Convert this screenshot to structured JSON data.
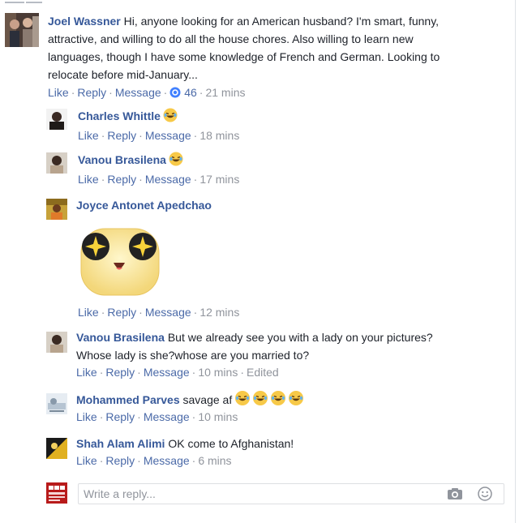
{
  "colors": {
    "author": "#365899",
    "link": "#4b6aa8",
    "meta": "#90949c",
    "reply_badge": "#4080ff"
  },
  "top_comment": {
    "author": "Joel Wassner",
    "lines": [
      "Hi, anyone looking for an American husband? I'm smart, funny,",
      "attractive, and willing to do all the house chores. Also willing to learn new",
      "languages, though I have some knowledge of French and German. Looking to",
      "relocate before mid-January..."
    ],
    "actions": {
      "like": "Like",
      "reply": "Reply",
      "message": "Message",
      "reply_count": "46",
      "time": "21 mins"
    },
    "reply_count_icon": "reply-bubble-icon"
  },
  "replies": [
    {
      "author": "Charles Whittle",
      "text": "",
      "emoji": "laughing-emoji",
      "actions": {
        "like": "Like",
        "reply": "Reply",
        "message": "Message",
        "time": "18 mins"
      }
    },
    {
      "author": "Vanou Brasilena",
      "text": "",
      "emoji": "laughing-emoji",
      "actions": {
        "like": "Like",
        "reply": "Reply",
        "message": "Message",
        "time": "17 mins"
      }
    },
    {
      "author": "Joyce Antonet Apedchao",
      "text": "",
      "sticker": "starry-eyes-sticker",
      "actions": {
        "like": "Like",
        "reply": "Reply",
        "message": "Message",
        "time": "12 mins"
      }
    },
    {
      "author": "Vanou Brasilena",
      "text": "But we already see you with a lady on your pictures?",
      "text2": "Whose lady is she?whose are you married to?",
      "actions": {
        "like": "Like",
        "reply": "Reply",
        "message": "Message",
        "time": "10 mins",
        "edited": "Edited"
      }
    },
    {
      "author": "Mohammed Parves",
      "text": "savage af",
      "emoji": "laughing-emoji",
      "emoji_count": 4,
      "actions": {
        "like": "Like",
        "reply": "Reply",
        "message": "Message",
        "time": "10 mins"
      }
    },
    {
      "author": "Shah Alam Alimi",
      "text": "OK come to Afghanistan!",
      "actions": {
        "like": "Like",
        "reply": "Reply",
        "message": "Message",
        "time": "6 mins"
      }
    }
  ],
  "reply_box": {
    "placeholder": "Write a reply...",
    "camera_icon": "camera-icon",
    "emoji_icon": "smiley-icon"
  }
}
